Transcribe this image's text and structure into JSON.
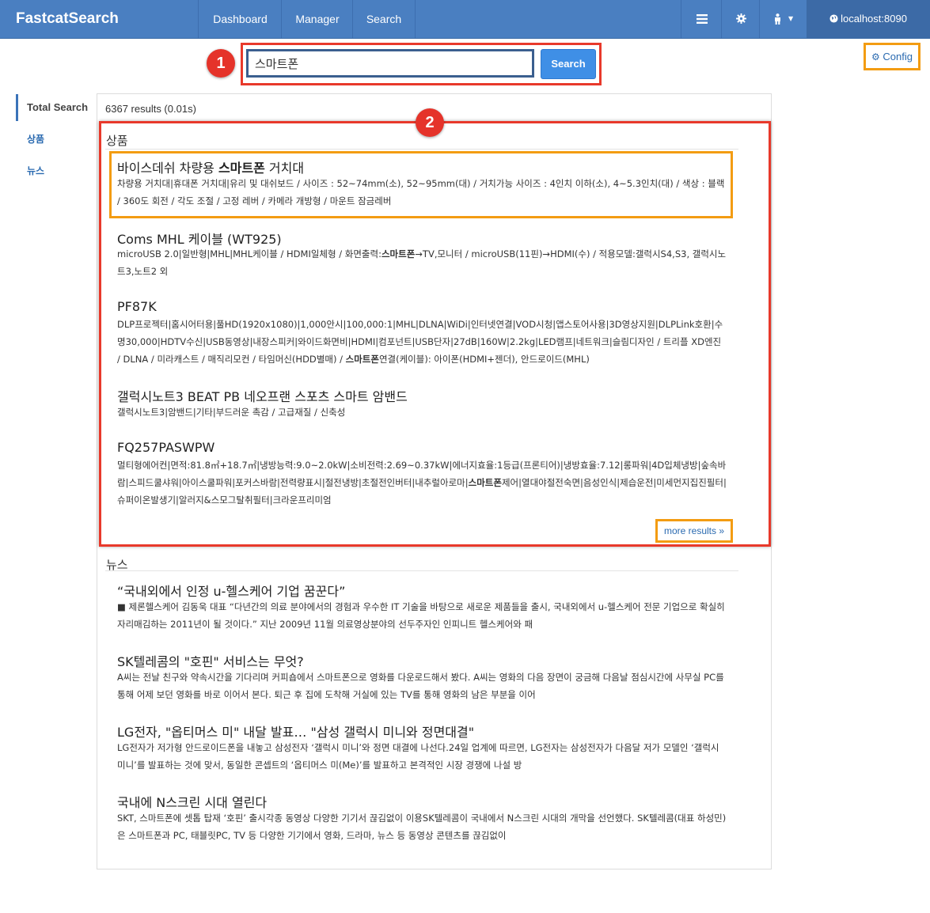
{
  "nav": {
    "brand": "FastcatSearch",
    "links": [
      "Dashboard",
      "Manager",
      "Search"
    ],
    "icons": [
      "list-icon",
      "gear-icon",
      "user-icon",
      "globe-icon"
    ],
    "host": "localhost:8090"
  },
  "search": {
    "query": "스마트폰",
    "button": "Search"
  },
  "badges": [
    "1",
    "2"
  ],
  "config": "Config",
  "sidebar": {
    "total": "Total Search",
    "items": [
      "상품",
      "뉴스"
    ]
  },
  "summary": "6367 results (0.01s)",
  "products": {
    "title": "상품",
    "items": [
      {
        "title_pre": "바이스데쉬 차량용 ",
        "title_hl": "스마트폰",
        "title_post": " 거치대",
        "desc": "차량용 거치대|휴대폰 거치대|유리 및 대쉬보드 / 사이즈 : 52~74mm(소), 52~95mm(대) / 거치가능 사이즈 : 4인치 이하(소), 4~5.3인치(대) / 색상 : 블랙 / 360도 회전 / 각도 조절 / 고정 레버 / 카메라 개방형 / 마운트 잠금레버"
      },
      {
        "title": "Coms MHL 케이블 (WT925)",
        "desc_pre": "microUSB 2.0|일반형|MHL|MHL케이블 / HDMI일체형 / 화면출력:",
        "desc_hl": "스마트폰",
        "desc_post": "→TV,모니터 / microUSB(11핀)→HDMI(수) / 적용모델:갤럭시S4,S3, 갤럭시노트3,노트2 외"
      },
      {
        "title": "PF87K",
        "desc_pre": "DLP프로젝터|홈시어터용|풀HD(1920x1080)|1,000안시|100,000:1|MHL|DLNA|WiDi|인터넷연결|VOD시청|앱스토어사용|3D영상지원|DLPLink호환|수명30,000|HDTV수신|USB동영상|내장스피커|와이드화면비|HDMI|컴포넌트|USB단자|27dB|160W|2.2kg|LED램프|네트워크|슬림디자인 / 트리플 XD엔진 / DLNA / 미라캐스트 / 매직리모컨 / 타임머신(HDD별매) / ",
        "desc_hl": "스마트폰",
        "desc_post": "연결(케이블): 아이폰(HDMI+젠더), 안드로이드(MHL)"
      },
      {
        "title": "갤럭시노트3 BEAT PB 네오프랜 스포츠 스마트 암밴드",
        "desc": "갤럭시노트3|암밴드|기타|부드러운 촉감 / 고급재질 / 신축성"
      },
      {
        "title": "FQ257PASWPW",
        "desc_pre": "멀티형에어컨|면적:81.8㎡+18.7㎡|냉방능력:9.0~2.0kW|소비전력:2.69~0.37kW|에너지효율:1등급(프론티어)|냉방효율:7.12|롱파워|4D입체냉방|숲속바람|스피드쿨샤워|아이스쿨파워|포커스바람|전력량표시|절전냉방|초절전인버터|내추럴아로마|",
        "desc_hl": "스마트폰",
        "desc_post": "제어|열대야절전숙면|음성인식|제습운전|미세먼지집진필터|슈퍼이온발생기|알러지&스모그탈취필터|크라운프리미엄"
      }
    ],
    "more": "more results »"
  },
  "news": {
    "title": "뉴스",
    "items": [
      {
        "title": "“국내외에서 인정 u-헬스케어 기업 꿈꾼다”",
        "desc": "■ 제론헬스케어 김동욱 대표 “다년간의 의료 분야에서의 경험과 우수한 IT 기술을 바탕으로 새로운 제품들을 출시, 국내외에서 u-헬스케어 전문 기업으로 확실히 자리매김하는 2011년이 될 것이다.” 지난 2009년 11월 의료영상분야의 선두주자인 인피니트 헬스케어와 패"
      },
      {
        "title": "SK텔레콤의 \"호핀\" 서비스는 무엇?",
        "desc": "A씨는 전날 친구와 약속시간을 기다리며 커피숍에서 스마트폰으로 영화를 다운로드해서 봤다. A씨는 영화의 다음 장면이 궁금해 다음날 점심시간에 사무실 PC를 통해 어제 보던 영화를 바로 이어서 본다. 퇴근 후 집에 도착해 거실에 있는 TV를 통해 영화의 남은 부분을 이어"
      },
      {
        "title": "LG전자, \"옵티머스 미\" 내달 발표… \"삼성 갤럭시 미니와 정면대결\"",
        "desc": "LG전자가 저가형 안드로이드폰을 내놓고 삼성전자 ‘갤럭시 미니’와 정면 대결에 나선다.24일 업계에 따르면, LG전자는 삼성전자가 다음달 저가 모델인 ‘갤럭시 미니’를 발표하는 것에 맞서, 동일한 콘셉트의 ‘옵티머스 미(Me)’를 발표하고 본격적인 시장 경쟁에 나설 방"
      },
      {
        "title": "국내에 N스크린 시대 열린다",
        "desc": "SKT, 스마트폰에 셋톱 탑재 ‘호핀’ 출시각종 동영상 다양한 기기서 끊김없이 이용SK텔레콤이 국내에서 N스크린 시대의 개막을 선언했다. SK텔레콤(대표 하성민)은 스마트폰과 PC, 태블릿PC, TV 등 다양한 기기에서 영화, 드라마, 뉴스 등 동영상 콘텐츠를 끊김없이"
      }
    ]
  }
}
